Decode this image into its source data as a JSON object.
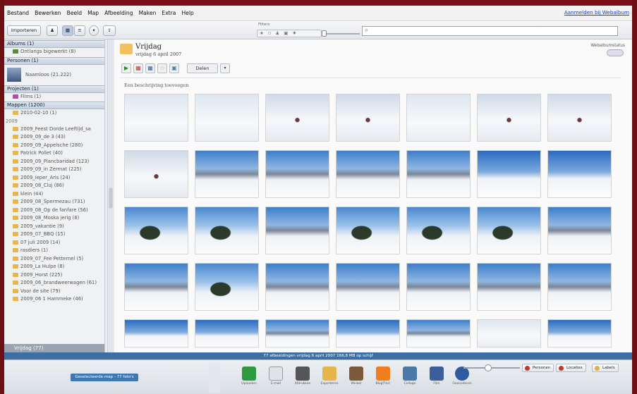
{
  "window": {
    "signin_link": "Aanmelden bij Webalbum"
  },
  "menu": [
    "Bestand",
    "Bewerken",
    "Beeld",
    "Map",
    "Afbeelding",
    "Maken",
    "Extra",
    "Help"
  ],
  "toolbar": {
    "import_label": "Importeren",
    "filters_label": "Filters",
    "filters_icons": "★ ▫ ♟ ▣ ♦",
    "search_placeholder": ""
  },
  "sidebar": {
    "albums_header": "Albums (1)",
    "album_item": "Ontlangs bigewerkt (8)",
    "persons_header": "Personen (1)",
    "person_item": "Naamloos (21.222)",
    "projects_header": "Projecten (1)",
    "project_item": "Films (1)",
    "folders_header": "Mappen (1200)",
    "year_2010_item": "2010-02-10 (1)",
    "year_2009": "2009",
    "folders": [
      "2009_Feest Dorde Leeftijd_sa",
      "2009_09_de 3 (43)",
      "2009_09_Appelsche (280)",
      "Patrick Pollet (40)",
      "2009_09_Plancbaridad (123)",
      "2009_09_in Zermat (225)",
      "2009_ieper_Aris (24)",
      "2009_08_Cluj (86)",
      "klein (44)",
      "2009_08_Spermezau (731)",
      "2009_08_Op de fanfare (56)",
      "2009_08_Moska jerig (6)",
      "2009_vakantie (9)",
      "2009_07_BBQ (15)",
      "07 juli 2009 (14)",
      "rasdiers (1)",
      "2009_07_Fee Petternel (5)",
      "2009_La Hulpe (8)",
      "2009_Horst (225)",
      "2009_06_brandweerwagen (61)",
      "Voor de site (79)",
      "2009_06 1 Hammeke (46)"
    ],
    "selected_item": "Vrijdag (77)"
  },
  "main": {
    "folder_title": "Vrijdag",
    "folder_date": "vrijdag 6 april 2007",
    "webalbum_label": "Webalbumstatus",
    "share_label": "Delen",
    "caption": "Een beschrijving toevoegen"
  },
  "status": {
    "text": "77 afbeeldingen    vrijdag 6 april 2007    166,8 MB op schijf"
  },
  "tray": {
    "chip": "Geselecteerde map - 77 foto's",
    "tools": [
      "Uploaden",
      "E-mail",
      "Afdrukken",
      "Exporteren",
      "Winkel",
      "BlogThis!",
      "Collage",
      "Film",
      "Geocoderen"
    ],
    "tag_buttons": [
      "Personen",
      "Locaties",
      "Labels"
    ]
  },
  "colors": {
    "accent": "#3d6fa3",
    "frame": "#6e0f14"
  },
  "thumbs": [
    [
      "snow",
      "snow",
      "skier",
      "skier",
      "snow",
      "skier",
      "skier"
    ],
    [
      "skier",
      "mount",
      "mount",
      "mount",
      "mount",
      "sky",
      "sky"
    ],
    [
      "tree",
      "tree",
      "mount",
      "tree",
      "tree",
      "tree",
      "mount"
    ],
    [
      "mount",
      "tree",
      "mount",
      "mount",
      "mount",
      "mount",
      "mount"
    ],
    [
      "sky",
      "sky",
      "mount",
      "sky",
      "mount",
      "snow",
      "sky"
    ]
  ]
}
